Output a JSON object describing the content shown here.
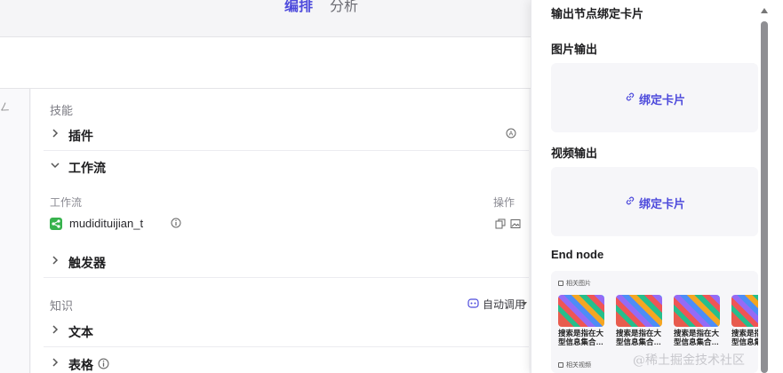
{
  "header": {
    "tab_edit": "编排",
    "tab_analysis": "分析"
  },
  "main": {
    "skills_title": "技能",
    "plugins_label": "插件",
    "workflow_label": "工作流",
    "workflow_col": "工作流",
    "workflow_op_col": "操作",
    "workflow_name": "mudidituijian_t",
    "triggers_label": "触发器",
    "knowledge_title": "知识",
    "auto_call_label": "自动调用",
    "text_label": "文本",
    "table_label": "表格"
  },
  "panel": {
    "title": "输出节点绑定卡片",
    "image_output": "图片输出",
    "video_output": "视频输出",
    "bind_card": "绑定卡片",
    "end_node": "End node",
    "related_images": "相关图片",
    "related_videos": "相关视频",
    "thumbs": [
      "搜索是指在大型信息集合…",
      "搜索是指在大型信息集合…",
      "搜索是指在大型信息集合…",
      "搜索是指在大型信息集合…"
    ]
  },
  "watermark": "@稀土掘金技术社区",
  "colors": {
    "accent": "#4e4bdc",
    "workflow_green": "#37b24d"
  }
}
